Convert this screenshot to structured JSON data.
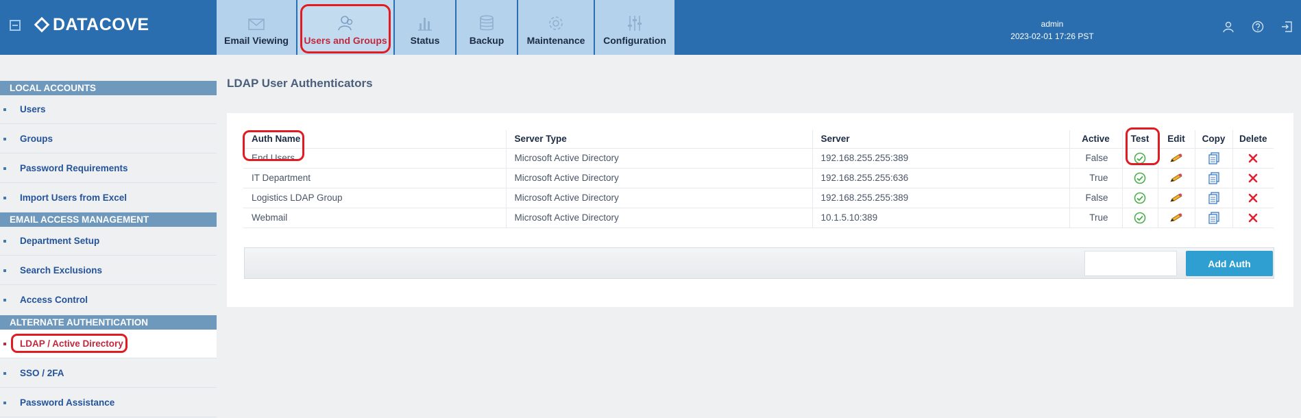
{
  "header": {
    "brand": "DATACOVE",
    "user": "admin",
    "datetime": "2023-02-01 17:26 PST",
    "tabs": [
      {
        "label": "Email Viewing",
        "icon": "envelope-icon"
      },
      {
        "label": "Users and Groups",
        "icon": "users-icon",
        "active": true
      },
      {
        "label": "Status",
        "icon": "bar-chart-icon"
      },
      {
        "label": "Backup",
        "icon": "database-icon"
      },
      {
        "label": "Maintenance",
        "icon": "gear-icon"
      },
      {
        "label": "Configuration",
        "icon": "sliders-icon"
      }
    ],
    "icons": [
      "user-profile-icon",
      "help-icon",
      "logout-icon"
    ]
  },
  "sidebar": {
    "sections": [
      {
        "title": "LOCAL ACCOUNTS",
        "items": [
          "Users",
          "Groups",
          "Password Requirements",
          "Import Users from Excel"
        ]
      },
      {
        "title": "EMAIL ACCESS MANAGEMENT",
        "items": [
          "Department Setup",
          "Search Exclusions",
          "Access Control"
        ]
      },
      {
        "title": "ALTERNATE AUTHENTICATION",
        "items": [
          "LDAP / Active Directory",
          "SSO / 2FA",
          "Password Assistance"
        ]
      }
    ],
    "active_item": "LDAP / Active Directory"
  },
  "main": {
    "title": "LDAP User Authenticators",
    "columns": [
      "Auth Name",
      "Server Type",
      "Server",
      "Active",
      "Test",
      "Edit",
      "Copy",
      "Delete"
    ],
    "rows": [
      {
        "name": "End Users",
        "type": "Microsoft Active Directory",
        "server": "192.168.255.255:389",
        "active": "False"
      },
      {
        "name": "IT Department",
        "type": "Microsoft Active Directory",
        "server": "192.168.255.255:636",
        "active": "True"
      },
      {
        "name": "Logistics LDAP Group",
        "type": "Microsoft Active Directory",
        "server": "192.168.255.255:389",
        "active": "False"
      },
      {
        "name": "Webmail",
        "type": "Microsoft Active Directory",
        "server": "10.1.5.10:389",
        "active": "True"
      }
    ],
    "add_button": "Add Auth",
    "add_input_value": ""
  },
  "colors": {
    "header_bg": "#2a6eaf",
    "tab_bg": "#b5d2ec",
    "section_bg": "#6f98bd",
    "active_text": "#c0283e",
    "add_button_bg": "#2f9fd1",
    "annotation": "#e21b23"
  }
}
